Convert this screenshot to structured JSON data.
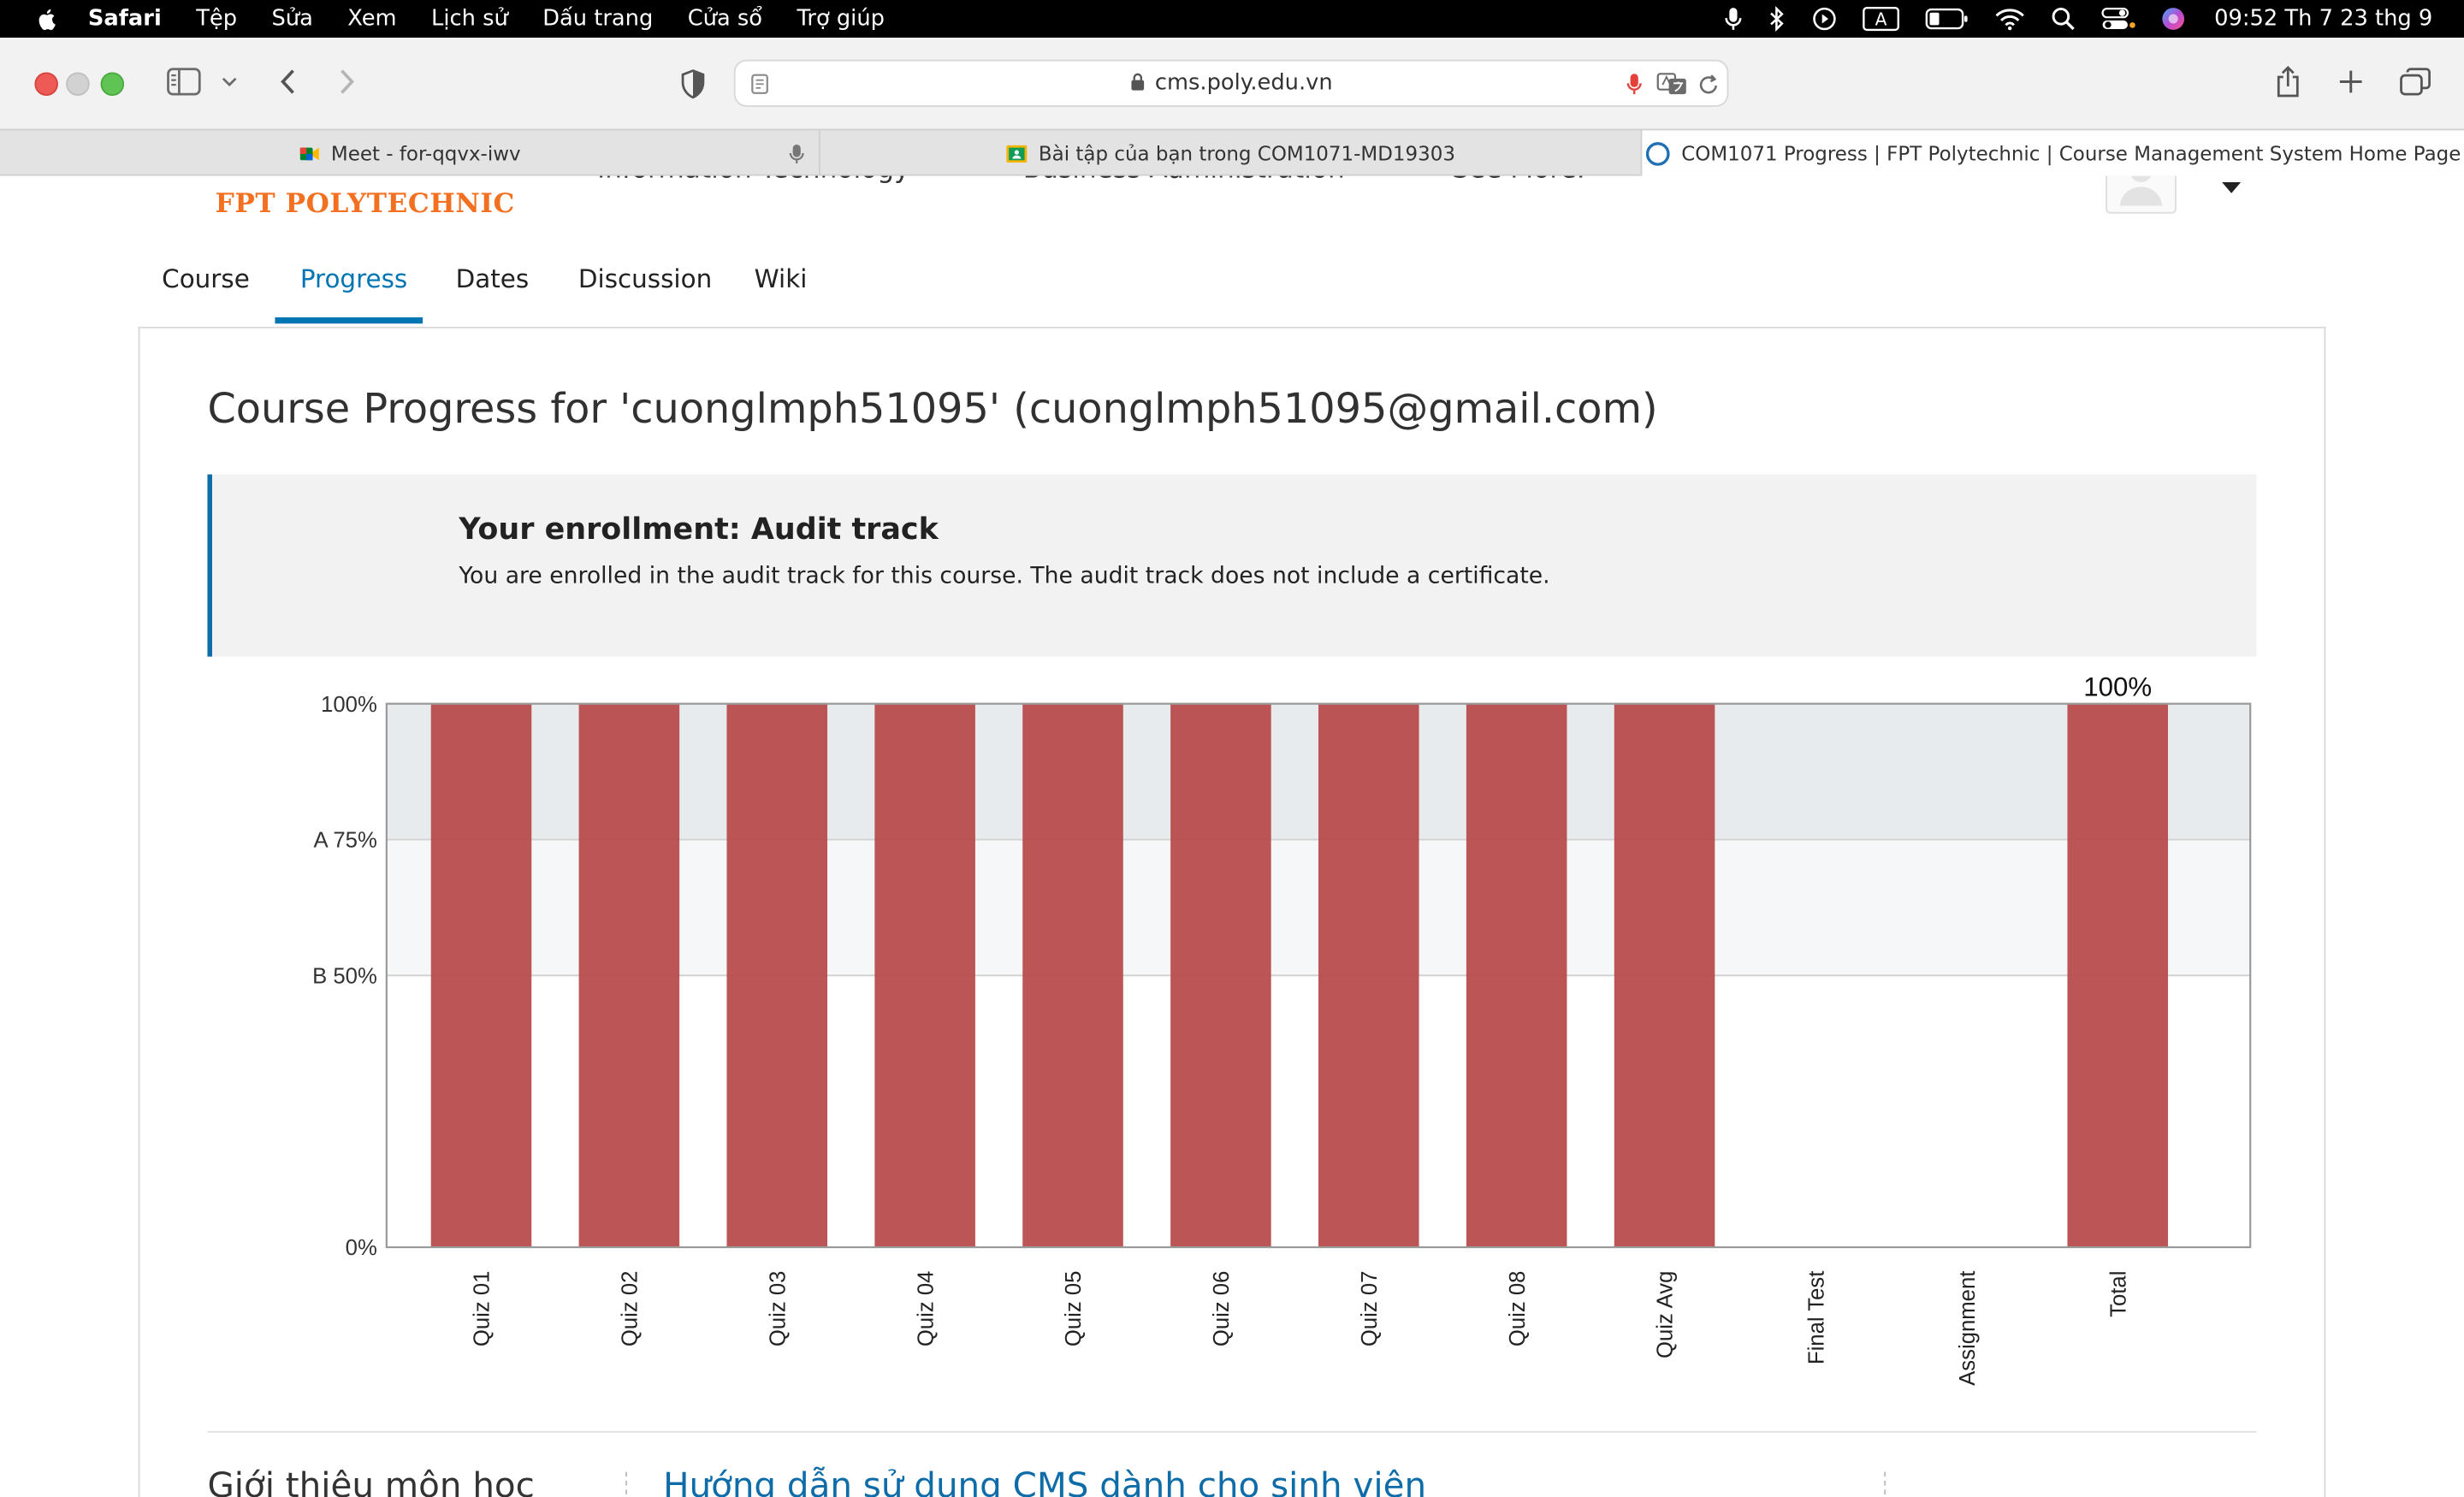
{
  "menubar": {
    "app": "Safari",
    "items": [
      "Tệp",
      "Sửa",
      "Xem",
      "Lịch sử",
      "Dấu trang",
      "Cửa sổ",
      "Trợ giúp"
    ],
    "clock": "09:52 Th 7 23 thg 9",
    "input_indicator": "A"
  },
  "toolbar": {
    "url": "cms.poly.edu.vn"
  },
  "tabs": [
    {
      "label": "Meet - for-qqvx-iwv"
    },
    {
      "label": "Bài tập của bạn trong COM1071-MD19303"
    },
    {
      "label": "COM1071 Progress | FPT Polytechnic | Course Management System Home Page"
    }
  ],
  "site": {
    "logo": "FPT POLYTECHNIC",
    "topnav": [
      "Information Technology",
      "Business Administration",
      "See More."
    ]
  },
  "course_nav": {
    "tabs": [
      "Course",
      "Progress",
      "Dates",
      "Discussion",
      "Wiki"
    ],
    "active": "Progress"
  },
  "main": {
    "title": "Course Progress for 'cuonglmph51095' (cuonglmph51095@gmail.com)",
    "enrollment_heading": "Your enrollment: Audit track",
    "enrollment_text": "You are enrolled in the audit track for this course. The audit track does not include a certificate."
  },
  "chart_data": {
    "type": "bar",
    "categories": [
      "Quiz 01",
      "Quiz 02",
      "Quiz 03",
      "Quiz 04",
      "Quiz 05",
      "Quiz 06",
      "Quiz 07",
      "Quiz 08",
      "Quiz Avg",
      "Final Test",
      "Assignment",
      "Total"
    ],
    "values": [
      100,
      100,
      100,
      100,
      100,
      100,
      100,
      100,
      100,
      0,
      0,
      100
    ],
    "ylim": [
      0,
      100
    ],
    "yticks": [
      {
        "value": 100,
        "label": "100%"
      },
      {
        "value": 75,
        "label": "A 75%"
      },
      {
        "value": 50,
        "label": "B 50%"
      },
      {
        "value": 0,
        "label": "0%"
      }
    ],
    "grade_bands": [
      {
        "grade": "A",
        "min": 75,
        "max": 100,
        "color": "#e8ebee"
      },
      {
        "grade": "B",
        "min": 50,
        "max": 75,
        "color": "#f5f7f9"
      }
    ],
    "total_label": "100%",
    "bar_color": "#b84c4c"
  },
  "below": {
    "left_heading": "Giới thiệu môn học",
    "link": "Hướng dẫn sử dụng CMS dành cho sinh viên"
  }
}
